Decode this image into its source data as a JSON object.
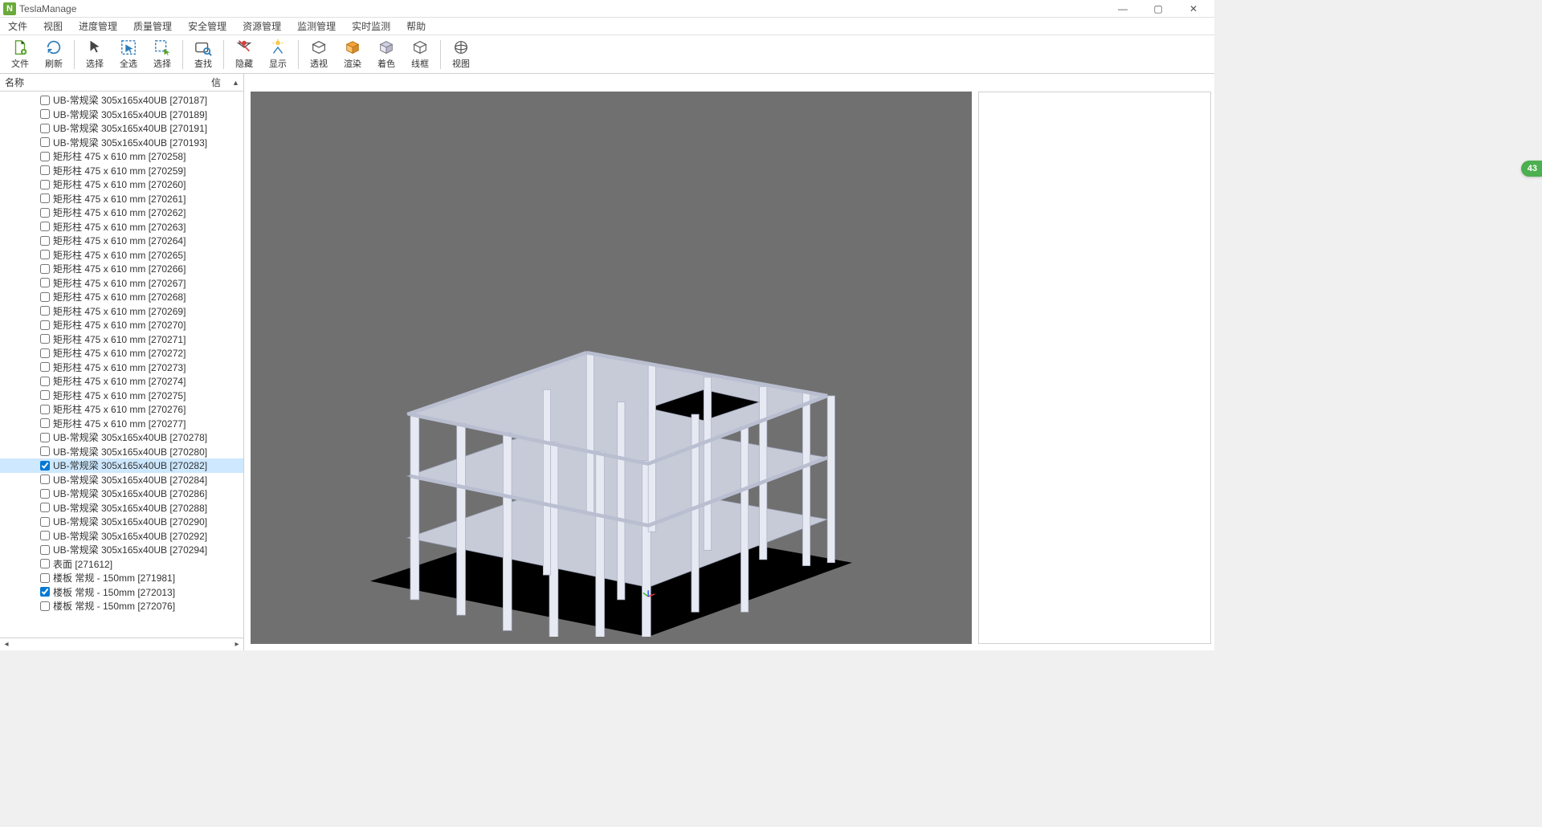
{
  "badge": "43",
  "titlebar": {
    "app_letter": "N",
    "title": "TeslaManage"
  },
  "menu": [
    "文件",
    "视图",
    "进度管理",
    "质量管理",
    "安全管理",
    "资源管理",
    "监测管理",
    "实时监测",
    "帮助"
  ],
  "toolbar": {
    "groups": [
      [
        {
          "name": "file-button",
          "label": "文件",
          "icon": "file-plus-icon"
        },
        {
          "name": "refresh-button",
          "label": "刷新",
          "icon": "refresh-icon"
        }
      ],
      [
        {
          "name": "pointer-button",
          "label": "选择",
          "icon": "pointer-icon"
        },
        {
          "name": "select-all-button",
          "label": "全选",
          "icon": "select-all-icon"
        },
        {
          "name": "select-button",
          "label": "选择",
          "icon": "select-arrow-icon"
        }
      ],
      [
        {
          "name": "find-button",
          "label": "查找",
          "icon": "find-icon"
        }
      ],
      [
        {
          "name": "hide-button",
          "label": "隐藏",
          "icon": "hide-icon"
        },
        {
          "name": "show-button",
          "label": "显示",
          "icon": "show-icon"
        }
      ],
      [
        {
          "name": "perspective-button",
          "label": "透视",
          "icon": "perspective-icon"
        },
        {
          "name": "render-button",
          "label": "渲染",
          "icon": "render-icon"
        },
        {
          "name": "shade-button",
          "label": "着色",
          "icon": "shade-icon"
        },
        {
          "name": "wireframe-button",
          "label": "线框",
          "icon": "wireframe-icon"
        }
      ],
      [
        {
          "name": "view-button",
          "label": "视图",
          "icon": "view-icon"
        }
      ]
    ]
  },
  "tree": {
    "header_name": "名称",
    "header_info": "信",
    "items": [
      {
        "checked": false,
        "selected": false,
        "label": "UB-常规梁 305x165x40UB [270187]"
      },
      {
        "checked": false,
        "selected": false,
        "label": "UB-常规梁 305x165x40UB [270189]"
      },
      {
        "checked": false,
        "selected": false,
        "label": "UB-常规梁 305x165x40UB [270191]"
      },
      {
        "checked": false,
        "selected": false,
        "label": "UB-常规梁 305x165x40UB [270193]"
      },
      {
        "checked": false,
        "selected": false,
        "label": "矩形柱 475 x 610 mm [270258]"
      },
      {
        "checked": false,
        "selected": false,
        "label": "矩形柱 475 x 610 mm [270259]"
      },
      {
        "checked": false,
        "selected": false,
        "label": "矩形柱 475 x 610 mm [270260]"
      },
      {
        "checked": false,
        "selected": false,
        "label": "矩形柱 475 x 610 mm [270261]"
      },
      {
        "checked": false,
        "selected": false,
        "label": "矩形柱 475 x 610 mm [270262]"
      },
      {
        "checked": false,
        "selected": false,
        "label": "矩形柱 475 x 610 mm [270263]"
      },
      {
        "checked": false,
        "selected": false,
        "label": "矩形柱 475 x 610 mm [270264]"
      },
      {
        "checked": false,
        "selected": false,
        "label": "矩形柱 475 x 610 mm [270265]"
      },
      {
        "checked": false,
        "selected": false,
        "label": "矩形柱 475 x 610 mm [270266]"
      },
      {
        "checked": false,
        "selected": false,
        "label": "矩形柱 475 x 610 mm [270267]"
      },
      {
        "checked": false,
        "selected": false,
        "label": "矩形柱 475 x 610 mm [270268]"
      },
      {
        "checked": false,
        "selected": false,
        "label": "矩形柱 475 x 610 mm [270269]"
      },
      {
        "checked": false,
        "selected": false,
        "label": "矩形柱 475 x 610 mm [270270]"
      },
      {
        "checked": false,
        "selected": false,
        "label": "矩形柱 475 x 610 mm [270271]"
      },
      {
        "checked": false,
        "selected": false,
        "label": "矩形柱 475 x 610 mm [270272]"
      },
      {
        "checked": false,
        "selected": false,
        "label": "矩形柱 475 x 610 mm [270273]"
      },
      {
        "checked": false,
        "selected": false,
        "label": "矩形柱 475 x 610 mm [270274]"
      },
      {
        "checked": false,
        "selected": false,
        "label": "矩形柱 475 x 610 mm [270275]"
      },
      {
        "checked": false,
        "selected": false,
        "label": "矩形柱 475 x 610 mm [270276]"
      },
      {
        "checked": false,
        "selected": false,
        "label": "矩形柱 475 x 610 mm [270277]"
      },
      {
        "checked": false,
        "selected": false,
        "label": "UB-常规梁 305x165x40UB [270278]"
      },
      {
        "checked": false,
        "selected": false,
        "label": "UB-常规梁 305x165x40UB [270280]"
      },
      {
        "checked": true,
        "selected": true,
        "label": "UB-常规梁 305x165x40UB [270282]"
      },
      {
        "checked": false,
        "selected": false,
        "label": "UB-常规梁 305x165x40UB [270284]"
      },
      {
        "checked": false,
        "selected": false,
        "label": "UB-常规梁 305x165x40UB [270286]"
      },
      {
        "checked": false,
        "selected": false,
        "label": "UB-常规梁 305x165x40UB [270288]"
      },
      {
        "checked": false,
        "selected": false,
        "label": "UB-常规梁 305x165x40UB [270290]"
      },
      {
        "checked": false,
        "selected": false,
        "label": "UB-常规梁 305x165x40UB [270292]"
      },
      {
        "checked": false,
        "selected": false,
        "label": "UB-常规梁 305x165x40UB [270294]"
      },
      {
        "checked": false,
        "selected": false,
        "label": "表面 [271612]"
      },
      {
        "checked": false,
        "selected": false,
        "label": "楼板 常规 - 150mm [271981]"
      },
      {
        "checked": true,
        "selected": false,
        "label": "楼板 常规 - 150mm [272013]"
      },
      {
        "checked": false,
        "selected": false,
        "label": "楼板 常规 - 150mm [272076]"
      }
    ]
  }
}
